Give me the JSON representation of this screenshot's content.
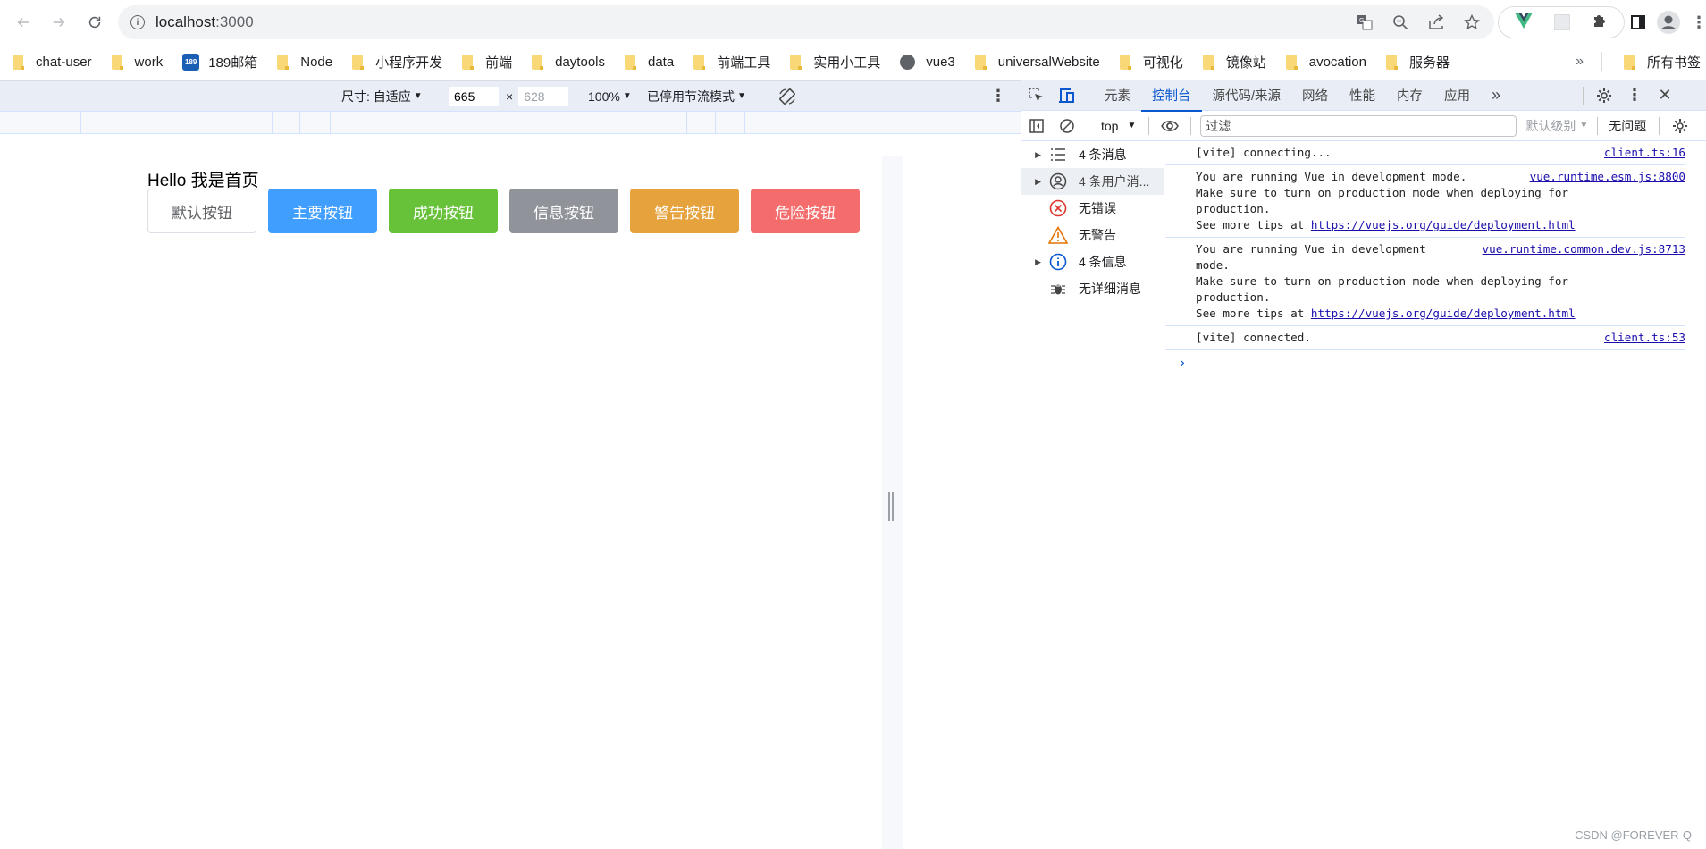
{
  "browser": {
    "url_host": "localhost",
    "url_port": ":3000",
    "bookmarks": [
      {
        "label": "chat-user",
        "icon": "folder-icon"
      },
      {
        "label": "work",
        "icon": "folder-icon"
      },
      {
        "label": "189邮箱",
        "icon": "mail189-icon",
        "badge": "189"
      },
      {
        "label": "Node",
        "icon": "folder-icon"
      },
      {
        "label": "小程序开发",
        "icon": "folder-icon"
      },
      {
        "label": "前端",
        "icon": "folder-icon"
      },
      {
        "label": "daytools",
        "icon": "folder-icon"
      },
      {
        "label": "data",
        "icon": "folder-icon"
      },
      {
        "label": "前端工具",
        "icon": "folder-icon"
      },
      {
        "label": "实用小工具",
        "icon": "folder-icon"
      },
      {
        "label": "vue3",
        "icon": "globe-icon"
      },
      {
        "label": "universalWebsite",
        "icon": "folder-icon"
      },
      {
        "label": "可视化",
        "icon": "folder-icon"
      },
      {
        "label": "镜像站",
        "icon": "folder-icon"
      },
      {
        "label": "avocation",
        "icon": "folder-icon"
      },
      {
        "label": "服务器",
        "icon": "folder-icon"
      }
    ],
    "bookmarks_more": "»",
    "all_bookmarks": "所有书签"
  },
  "device_toolbar": {
    "size_label": "尺寸: 自适应",
    "width": "665",
    "x_sep": "×",
    "height": "628",
    "zoom": "100%",
    "throttle": "已停用节流模式"
  },
  "page": {
    "heading": "Hello 我是首页",
    "buttons": [
      {
        "label": "默认按钮",
        "type": "default",
        "color": "#ffffff"
      },
      {
        "label": "主要按钮",
        "type": "primary",
        "color": "#409eff"
      },
      {
        "label": "成功按钮",
        "type": "success",
        "color": "#67c23a"
      },
      {
        "label": "信息按钮",
        "type": "info",
        "color": "#909399"
      },
      {
        "label": "警告按钮",
        "type": "warning",
        "color": "#e6a23c"
      },
      {
        "label": "危险按钮",
        "type": "danger",
        "color": "#f56c6c"
      }
    ]
  },
  "devtools": {
    "tabs": [
      "元素",
      "控制台",
      "源代码/来源",
      "网络",
      "性能",
      "内存",
      "应用"
    ],
    "active_tab": "控制台",
    "more_tabs": "»",
    "context": "top",
    "filter_placeholder": "过滤",
    "level": "默认级别",
    "issues": "无问题",
    "sidebar": [
      {
        "label": "4 条消息",
        "icon": "list-icon",
        "expandable": true
      },
      {
        "label": "4 条用户消...",
        "icon": "user-icon",
        "expandable": true,
        "selected": true
      },
      {
        "label": "无错误",
        "icon": "error-icon",
        "expandable": false
      },
      {
        "label": "无警告",
        "icon": "warning-icon",
        "expandable": false
      },
      {
        "label": "4 条信息",
        "icon": "info-icon",
        "expandable": true
      },
      {
        "label": "无详细消息",
        "icon": "bug-icon",
        "expandable": false
      }
    ],
    "messages": [
      {
        "text": "[vite] connecting...",
        "source": "client.ts:16"
      },
      {
        "text": "You are running Vue in development mode.\nMake sure to turn on production mode when deploying for\nproduction.\nSee more tips at ",
        "link": "https://vuejs.org/guide/deployment.html",
        "source": "vue.runtime.esm.js:8800"
      },
      {
        "text": "You are running Vue in development\nmode.\nMake sure to turn on production mode when deploying for\nproduction.\nSee more tips at ",
        "link": "https://vuejs.org/guide/deployment.html",
        "source": "vue.runtime.common.dev.js:8713"
      },
      {
        "text": "[vite] connected.",
        "source": "client.ts:53"
      }
    ],
    "prompt": "›"
  },
  "watermark": "CSDN @FOREVER-Q"
}
